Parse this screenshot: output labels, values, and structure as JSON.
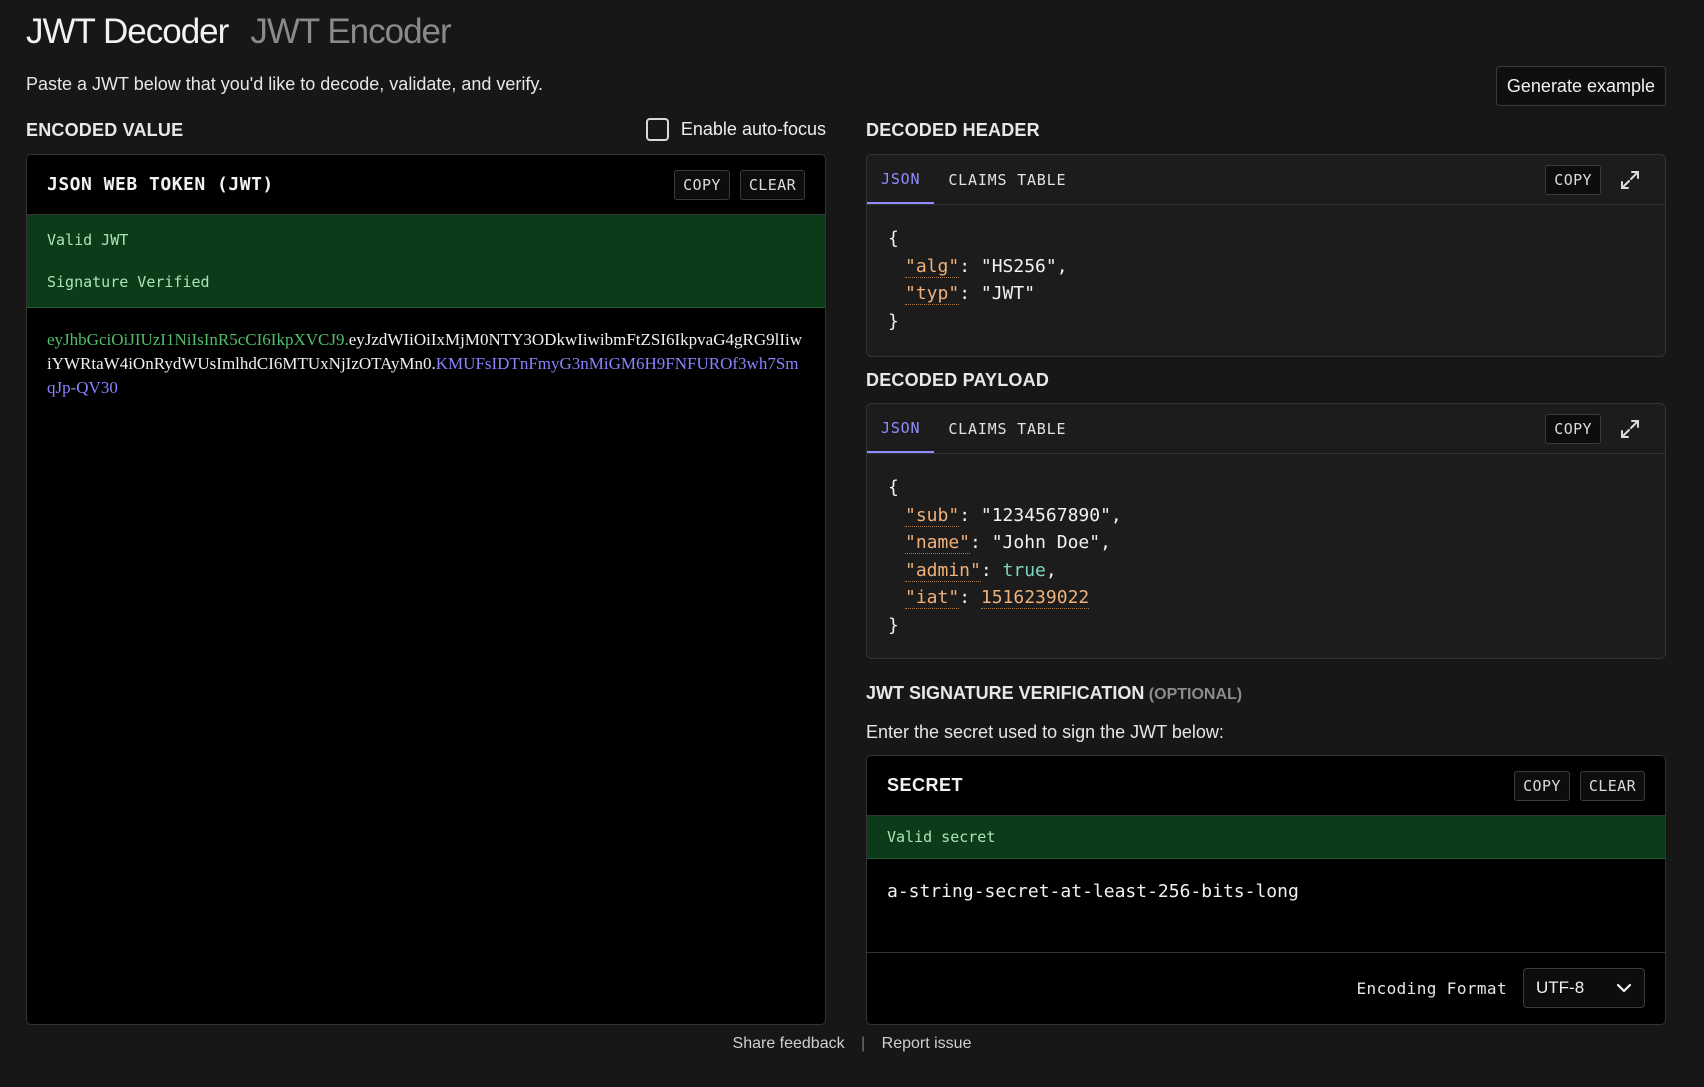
{
  "header": {
    "tabs": [
      "JWT Decoder",
      "JWT Encoder"
    ],
    "subtitle": "Paste a JWT below that you'd like to decode, validate, and verify.",
    "generate_label": "Generate example"
  },
  "encoded": {
    "section_label": "ENCODED VALUE",
    "autofocus_label": "Enable auto-focus",
    "autofocus_checked": false,
    "panel_title": "JSON WEB TOKEN (JWT)",
    "copy_label": "COPY",
    "clear_label": "CLEAR",
    "status": [
      "Valid JWT",
      "Signature Verified"
    ],
    "token_header": "eyJhbGciOiJIUzI1NiIsInR5cCI6IkpXVCJ9",
    "token_payload": "eyJzdWIiOiIxMjM0NTY3ODkwIiwibmFtZSI6IkpvaG4gRG9lIiwiYWRtaW4iOnRydWUsImlhdCI6MTUxNjIzOTAyMn0",
    "token_signature": "KMUFsIDTnFmyG3nMiGM6H9FNFUROf3wh7SmqJp-QV30",
    "dot": "."
  },
  "decoded_header": {
    "section_label": "DECODED HEADER",
    "tabs": [
      "JSON",
      "CLAIMS TABLE"
    ],
    "copy_label": "COPY",
    "open_brace": "{",
    "close_brace": "}",
    "alg_key": "\"alg\"",
    "alg_val": "\"HS256\"",
    "typ_key": "\"typ\"",
    "typ_val": "\"JWT\""
  },
  "decoded_payload": {
    "section_label": "DECODED PAYLOAD",
    "tabs": [
      "JSON",
      "CLAIMS TABLE"
    ],
    "copy_label": "COPY",
    "open_brace": "{",
    "close_brace": "}",
    "sub_key": "\"sub\"",
    "sub_val": "\"1234567890\"",
    "name_key": "\"name\"",
    "name_val": "\"John Doe\"",
    "admin_key": "\"admin\"",
    "admin_val": "true",
    "iat_key": "\"iat\"",
    "iat_val": "1516239022"
  },
  "signature": {
    "title": "JWT SIGNATURE VERIFICATION",
    "optional": "(OPTIONAL)",
    "description": "Enter the secret used to sign the JWT below:",
    "panel_title": "SECRET",
    "copy_label": "COPY",
    "clear_label": "CLEAR",
    "status": "Valid secret",
    "secret_value": "a-string-secret-at-least-256-bits-long",
    "encoding_label": "Encoding Format",
    "encoding_value": "UTF-8"
  },
  "footer": {
    "feedback": "Share feedback",
    "separator": "|",
    "report": "Report issue"
  },
  "colors": {
    "background": "#171717",
    "valid_green": "#0c3b19",
    "token_header": "#4fbf6a",
    "token_signature": "#8a82ff",
    "tab_accent": "#8f8cff",
    "json_key": "#f0b07a"
  }
}
